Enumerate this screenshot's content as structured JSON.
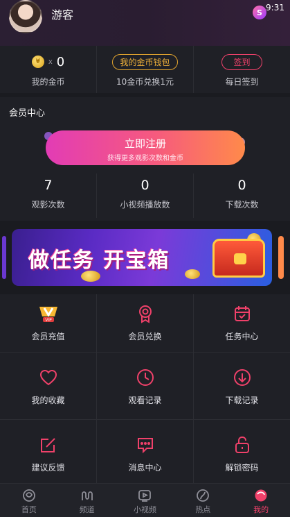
{
  "status": {
    "time": "9:31",
    "app_badge": "S"
  },
  "profile": {
    "username": "游客"
  },
  "coins": {
    "count": "0",
    "x_label": "x",
    "my_coins_label": "我的金币",
    "wallet_button": "我的金币钱包",
    "exchange_text": "10金币兑换1元",
    "signin_button": "签到",
    "daily_signin_label": "每日签到"
  },
  "member": {
    "title": "会员中心",
    "register_button": "立即注册",
    "register_sub": "获得更多观影次数和金币",
    "stats": [
      {
        "value": "7",
        "label": "观影次数"
      },
      {
        "value": "0",
        "label": "小视频播放数"
      },
      {
        "value": "0",
        "label": "下载次数"
      }
    ]
  },
  "banner": {
    "text": "做任务 开宝箱"
  },
  "menu": {
    "row1": [
      {
        "label": "会员充值",
        "icon": "vip-icon"
      },
      {
        "label": "会员兑换",
        "icon": "badge-icon"
      },
      {
        "label": "任务中心",
        "icon": "calendar-check-icon"
      }
    ],
    "row2": [
      {
        "label": "我的收藏",
        "icon": "heart-icon"
      },
      {
        "label": "观看记录",
        "icon": "clock-icon"
      },
      {
        "label": "下载记录",
        "icon": "download-icon"
      }
    ],
    "row3": [
      {
        "label": "建议反馈",
        "icon": "edit-icon"
      },
      {
        "label": "消息中心",
        "icon": "message-icon"
      },
      {
        "label": "解锁密码",
        "icon": "unlock-icon"
      }
    ]
  },
  "tabs": [
    {
      "label": "首页",
      "icon": "home-icon"
    },
    {
      "label": "频道",
      "icon": "channel-icon"
    },
    {
      "label": "小视频",
      "icon": "video-icon"
    },
    {
      "label": "热点",
      "icon": "hot-icon"
    },
    {
      "label": "我的",
      "icon": "profile-icon",
      "active": true
    }
  ],
  "colors": {
    "accent": "#f0416a",
    "gold": "#f0b13a",
    "background": "#1a1b20"
  }
}
